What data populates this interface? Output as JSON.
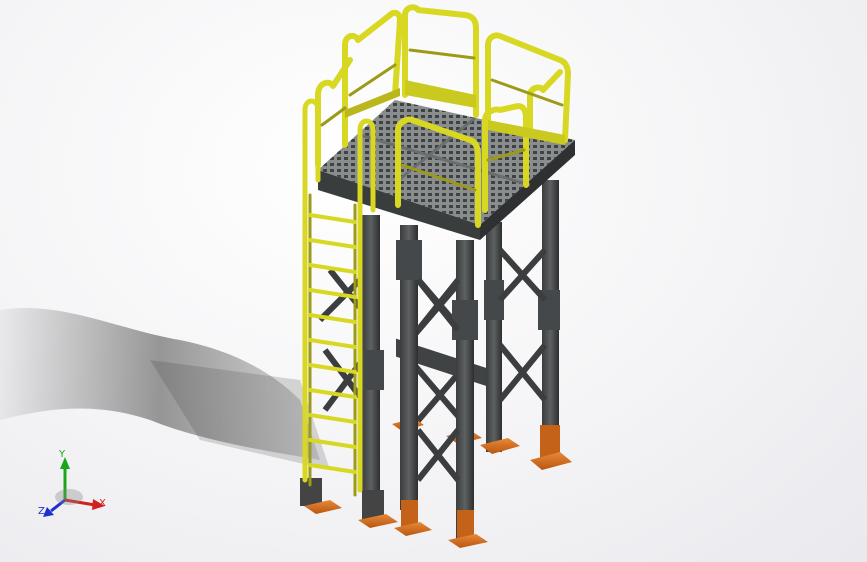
{
  "viewport": {
    "background": "#f3f3f5",
    "model": {
      "description_visible": false,
      "colors": {
        "railing": "#d8d823",
        "railing_dark": "#9d9a18",
        "steel": "#505353",
        "steel_dark": "#2d2f30",
        "base_plate": "#d9741c",
        "grating": "#7c7f80"
      }
    }
  },
  "triad": {
    "x_label": "X",
    "y_label": "Y",
    "z_label": "Z",
    "x_color": "#d21f1f",
    "y_color": "#1aa61a",
    "z_color": "#2030d0"
  }
}
